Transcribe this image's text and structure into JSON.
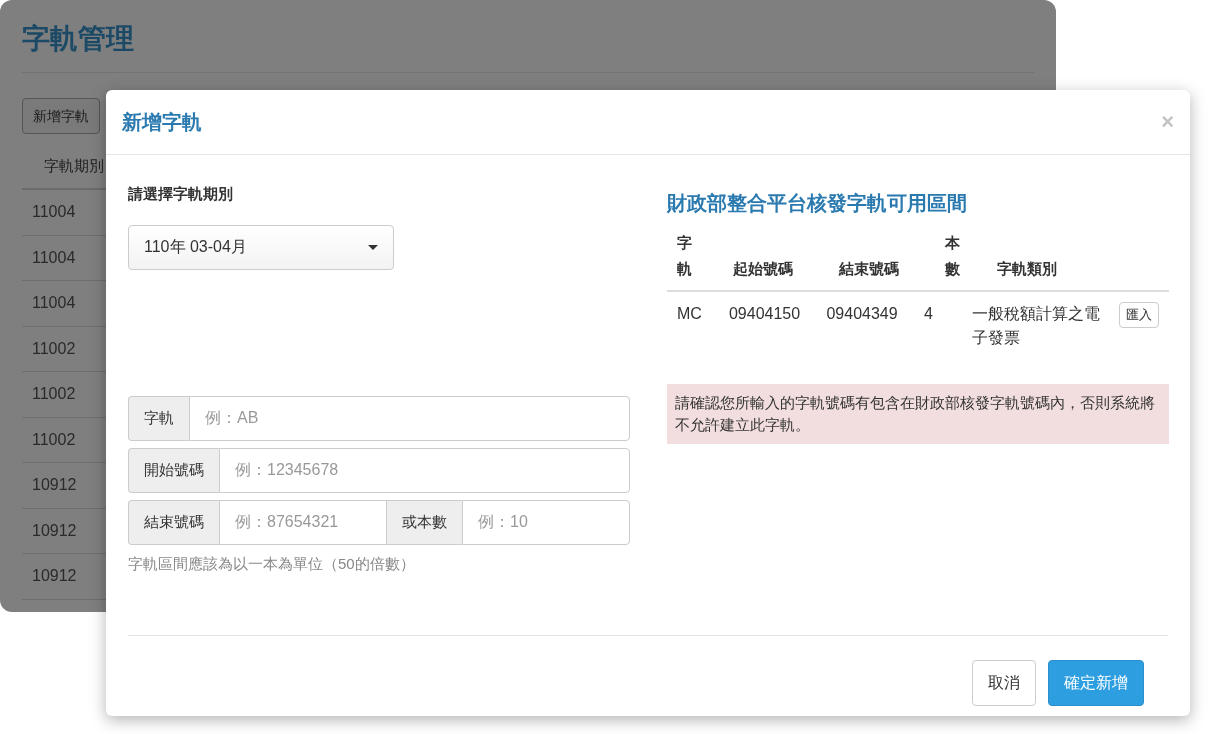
{
  "page": {
    "title": "字軌管理",
    "add_button": "新增字軌",
    "table": {
      "columns": [
        "字軌期別"
      ],
      "rows": [
        "11004",
        "11004",
        "11004",
        "11002",
        "11002",
        "11002",
        "10912",
        "10912",
        "10912"
      ]
    }
  },
  "modal": {
    "title": "新增字軌",
    "close": "×",
    "period_label": "請選擇字軌期別",
    "period_select": {
      "value": "110年 03-04月"
    },
    "field_rows": [
      [
        {
          "addon": "字軌",
          "placeholder": "例：AB"
        }
      ],
      [
        {
          "addon": "開始號碼",
          "placeholder": "例：12345678"
        }
      ],
      [
        {
          "addon": "結束號碼",
          "placeholder": "例：87654321"
        },
        {
          "addon": "或本數",
          "placeholder": "例：10"
        }
      ]
    ],
    "help": "字軌區間應該為以一本為單位（50的倍數）",
    "range_title": "財政部整合平台核發字軌可用區間",
    "range_table": {
      "columns": [
        "字軌",
        "起始號碼",
        "結束號碼",
        "本數",
        "字軌類別"
      ],
      "rows": [
        {
          "cells": [
            "MC",
            "09404150",
            "09404349",
            "4",
            "一般稅額計算之電子發票"
          ],
          "action": "匯入"
        }
      ]
    },
    "alert": "請確認您所輸入的字軌號碼有包含在財政部核發字軌號碼內，否則系統將不允許建立此字軌。",
    "buttons": [
      {
        "label": "取消",
        "kind": "default"
      },
      {
        "label": "確定新增",
        "kind": "primary"
      }
    ]
  }
}
